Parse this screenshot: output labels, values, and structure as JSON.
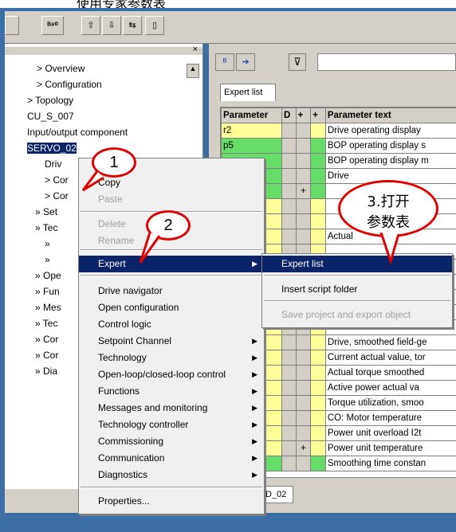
{
  "top_caption": "使用专家参数表",
  "toolbar": {
    "buttons": [
      "",
      "图",
      "",
      "",
      "",
      ""
    ]
  },
  "right_toolbar": {
    "filter_value": ""
  },
  "tab_expert_list": "Expert list",
  "grid": {
    "headers": [
      "Parameter",
      "D",
      "+",
      "+",
      "Parameter text"
    ],
    "rows": [
      {
        "param": "r2",
        "plus": "",
        "text": "Drive operating display",
        "color": "#ffff99"
      },
      {
        "param": "p5",
        "plus": "",
        "text": "BOP operating display s",
        "color": "#66dd66"
      },
      {
        "param": "",
        "plus": "",
        "text": "BOP operating display m",
        "color": "#66dd66"
      },
      {
        "param": "",
        "plus": "",
        "text": "Drive",
        "color": "#66dd66"
      },
      {
        "param": "",
        "plus": "+",
        "text": "",
        "color": "#66dd66"
      },
      {
        "param": "",
        "plus": "",
        "text": "",
        "color": "#ffff99"
      },
      {
        "param": "",
        "plus": "",
        "text": "",
        "color": "#ffff99"
      },
      {
        "param": "",
        "plus": "",
        "text": "Actual",
        "color": "#ffff99"
      },
      {
        "param": "",
        "plus": "",
        "text": "",
        "color": "#ffff99"
      },
      {
        "param": "",
        "plus": "",
        "text": "",
        "color": "#ffff99"
      },
      {
        "param": "",
        "plus": "",
        "text": "",
        "color": "#ffff99"
      },
      {
        "param": "",
        "plus": "",
        "text": "",
        "color": "#ffff99"
      },
      {
        "param": "",
        "plus": "",
        "text": "",
        "color": "#ffff99"
      },
      {
        "param": "",
        "plus": "",
        "text": "",
        "color": "#ffff99"
      },
      {
        "param": "",
        "plus": "",
        "text": "Drive, smoothed field-ge",
        "color": "#ffff99"
      },
      {
        "param": "",
        "plus": "",
        "text": "Current actual value, tor",
        "color": "#ffff99"
      },
      {
        "param": "",
        "plus": "",
        "text": "Actual torque smoothed",
        "color": "#ffff99"
      },
      {
        "param": "",
        "plus": "",
        "text": "Active power actual va",
        "color": "#ffff99"
      },
      {
        "param": "",
        "plus": "",
        "text": "Torque utilization, smoo",
        "color": "#ffff99"
      },
      {
        "param": "",
        "plus": "",
        "text": "CO: Motor temperature",
        "color": "#ffff99"
      },
      {
        "param": "",
        "plus": "",
        "text": "Power unit overload I2t",
        "color": "#ffff99"
      },
      {
        "param": "",
        "plus": "+",
        "text": "Power unit temperature",
        "color": "#ffff99"
      },
      {
        "param": "",
        "plus": "",
        "text": "Smoothing time constan",
        "color": "#66dd66"
      }
    ]
  },
  "tree": {
    "items": [
      {
        "label": "Overview",
        "indent": 40,
        "sym": ">"
      },
      {
        "label": "Configuration",
        "indent": 40,
        "sym": ">"
      },
      {
        "label": "Topology",
        "indent": 28,
        "sym": ">"
      },
      {
        "label": "CU_S_007",
        "indent": 28,
        "sym": ""
      },
      {
        "label": "Input/output component",
        "indent": 28,
        "sym": ""
      },
      {
        "label": "SERVO_02",
        "indent": 28,
        "sym": ""
      },
      {
        "label": "Driv",
        "indent": 50,
        "sym": ""
      },
      {
        "label": "Cor",
        "indent": 50,
        "sym": ">"
      },
      {
        "label": "Cor",
        "indent": 50,
        "sym": ">"
      },
      {
        "label": "Set",
        "indent": 38,
        "sym": "»"
      },
      {
        "label": "Tec",
        "indent": 38,
        "sym": "»"
      },
      {
        "label": "",
        "indent": 50,
        "sym": "»"
      },
      {
        "label": "",
        "indent": 50,
        "sym": "»"
      },
      {
        "label": "Ope",
        "indent": 38,
        "sym": "»"
      },
      {
        "label": "Fun",
        "indent": 38,
        "sym": "»"
      },
      {
        "label": "Mes",
        "indent": 38,
        "sym": "»"
      },
      {
        "label": "Tec",
        "indent": 38,
        "sym": "»"
      },
      {
        "label": "Cor",
        "indent": 38,
        "sym": "»"
      },
      {
        "label": "Cor",
        "indent": 38,
        "sym": "»"
      },
      {
        "label": "Dia",
        "indent": 38,
        "sym": "»"
      }
    ]
  },
  "context_menu": {
    "items": [
      {
        "label": "Copy",
        "disabled": false
      },
      {
        "label": "Paste",
        "disabled": true
      },
      {
        "label": "Delete",
        "disabled": true
      },
      {
        "label": "Rename",
        "disabled": true
      },
      {
        "label": "Expert",
        "disabled": false,
        "submenu": true,
        "selected": true
      },
      {
        "label": "Drive navigator",
        "disabled": false
      },
      {
        "label": "Open configuration",
        "disabled": false
      },
      {
        "label": "Control logic",
        "disabled": false
      },
      {
        "label": "Setpoint Channel",
        "disabled": false,
        "submenu": true
      },
      {
        "label": "Technology",
        "disabled": false,
        "submenu": true
      },
      {
        "label": "Open-loop/closed-loop control",
        "disabled": false,
        "submenu": true
      },
      {
        "label": "Functions",
        "disabled": false,
        "submenu": true
      },
      {
        "label": "Messages and monitoring",
        "disabled": false,
        "submenu": true
      },
      {
        "label": "Technology controller",
        "disabled": false,
        "submenu": true
      },
      {
        "label": "Commissioning",
        "disabled": false,
        "submenu": true
      },
      {
        "label": "Communication",
        "disabled": false,
        "submenu": true
      },
      {
        "label": "Diagnostics",
        "disabled": false,
        "submenu": true
      },
      {
        "label": "Properties...",
        "disabled": false
      }
    ]
  },
  "submenu": {
    "items": [
      {
        "label": "Expert list",
        "disabled": false,
        "selected": true
      },
      {
        "label": "Insert script folder",
        "disabled": false
      },
      {
        "label": "Save project and export object",
        "disabled": true
      }
    ]
  },
  "callouts": {
    "one": "1",
    "two": "2",
    "three_line1": "3.打开",
    "three_line2": "参数表"
  },
  "bottom_tab": "D_02",
  "status_text": ""
}
